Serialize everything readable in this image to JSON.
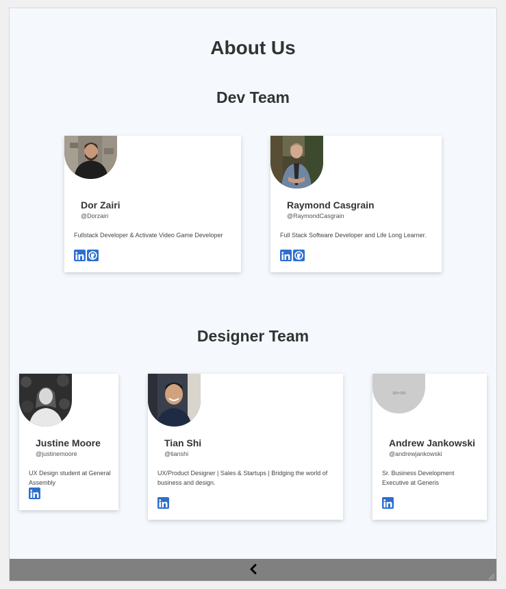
{
  "page": {
    "title": "About Us"
  },
  "dev_team": {
    "title": "Dev Team",
    "members": [
      {
        "name": "Dor Zairi",
        "handle": "@Dorzairi",
        "bio": "Fullstack Developer & Activate Video Game Developer",
        "links": [
          "linkedin-icon",
          "github-icon"
        ]
      },
      {
        "name": "Raymond Casgrain",
        "handle": "@RaymondCasgrain",
        "bio": "Full Stack Software Developer and Life Long Learner.",
        "links": [
          "linkedin-icon",
          "github-icon"
        ]
      }
    ]
  },
  "designer_team": {
    "title": "Designer Team",
    "members": [
      {
        "name": "Justine Moore",
        "handle": "@justinemoore",
        "bio": "UX Design student at General Assembly",
        "links": [
          "linkedin-icon"
        ]
      },
      {
        "name": "Tian Shi",
        "handle": "@tianshi",
        "bio": "UX/Product Designer | Sales & Startups | Bridging the world of business and design.",
        "links": [
          "linkedin-icon"
        ]
      },
      {
        "name": "Andrew Jankowski",
        "handle": "@andrewjankowski",
        "bio": "Sr. Business Development Executive at Generis",
        "placeholder_text": "150×150",
        "links": [
          "linkedin-icon"
        ]
      }
    ]
  },
  "footer": {
    "back_icon": "chevron-left-icon"
  },
  "colors": {
    "background": "#f5f9fd",
    "icon_blue": "#2d6fd0",
    "footer_gray": "#808080"
  }
}
